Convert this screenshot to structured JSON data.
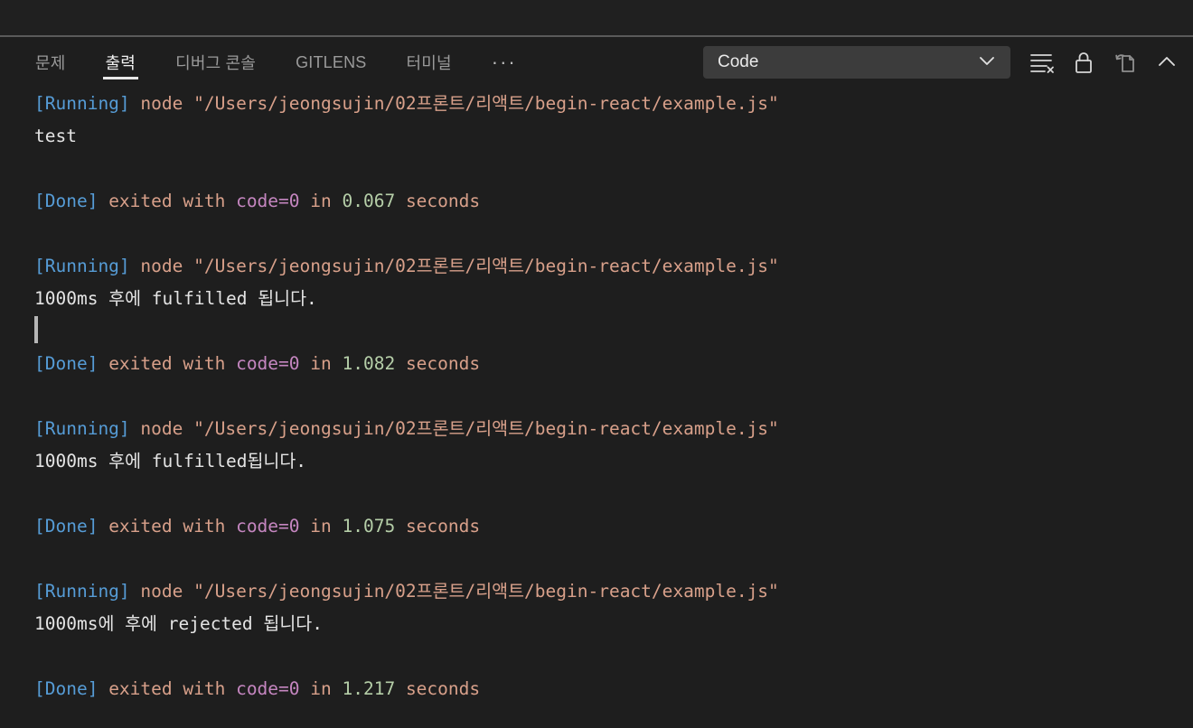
{
  "panel": {
    "tabs": [
      {
        "label": "문제",
        "name": "tab-problems",
        "active": false
      },
      {
        "label": "출력",
        "name": "tab-output",
        "active": true
      },
      {
        "label": "디버그 콘솔",
        "name": "tab-debug-console",
        "active": false
      },
      {
        "label": "GITLENS",
        "name": "tab-gitlens",
        "active": false
      },
      {
        "label": "터미널",
        "name": "tab-terminal",
        "active": false
      }
    ],
    "more_label": "···",
    "channel_select": {
      "value": "Code",
      "icon": "chevron-down-icon"
    },
    "actions": [
      {
        "name": "clear-output-button",
        "icon": "clear-output-icon",
        "title": "Clear Output"
      },
      {
        "name": "turn-auto-scrolling-off-button",
        "icon": "lock-icon",
        "title": "Turn Auto Scrolling Off"
      },
      {
        "name": "open-output-in-editor-button",
        "icon": "open-in-editor-icon",
        "title": "Open Output in Editor"
      },
      {
        "name": "hide-panel-button",
        "icon": "chevron-up-icon",
        "title": "Hide Panel"
      }
    ]
  },
  "colors": {
    "background": "#1e1e1e",
    "tag": "#569cd6",
    "body_text": "#d8a08a",
    "code_value": "#c586c0",
    "number": "#b5cea8",
    "program_output": "#e4e4e4",
    "accent_underline": "#e7e7e7",
    "select_background": "#3c3c3c"
  },
  "output": {
    "command": "node \"/Users/jeongsujin/02프론트/리액트/begin-react/example.js\"",
    "running_tag": "[Running]",
    "done_tag": "[Done]",
    "exited_text": "exited with ",
    "code_text": "code=0",
    "in_text": " in ",
    "seconds_text": " seconds",
    "lines": [
      {
        "type": "running",
        "tag": "[Running]",
        "rest": " node \"/Users/jeongsujin/02프론트/리액트/begin-react/example.js\""
      },
      {
        "type": "stdout",
        "text": "test"
      },
      {
        "type": "blank",
        "text": ""
      },
      {
        "type": "done",
        "tag": "[Done]",
        "pre": " exited with ",
        "code": "code=0",
        "mid": " in ",
        "num": "0.067",
        "post": " seconds"
      },
      {
        "type": "blank",
        "text": ""
      },
      {
        "type": "running",
        "tag": "[Running]",
        "rest": " node \"/Users/jeongsujin/02프론트/리액트/begin-react/example.js\""
      },
      {
        "type": "stdout",
        "text": "1000ms 후에 fulfilled 됩니다."
      },
      {
        "type": "caret",
        "text": ""
      },
      {
        "type": "done",
        "tag": "[Done]",
        "pre": " exited with ",
        "code": "code=0",
        "mid": " in ",
        "num": "1.082",
        "post": " seconds"
      },
      {
        "type": "blank",
        "text": ""
      },
      {
        "type": "running",
        "tag": "[Running]",
        "rest": " node \"/Users/jeongsujin/02프론트/리액트/begin-react/example.js\""
      },
      {
        "type": "stdout",
        "text": "1000ms 후에 fulfilled됩니다."
      },
      {
        "type": "blank",
        "text": ""
      },
      {
        "type": "done",
        "tag": "[Done]",
        "pre": " exited with ",
        "code": "code=0",
        "mid": " in ",
        "num": "1.075",
        "post": " seconds"
      },
      {
        "type": "blank",
        "text": ""
      },
      {
        "type": "running",
        "tag": "[Running]",
        "rest": " node \"/Users/jeongsujin/02프론트/리액트/begin-react/example.js\""
      },
      {
        "type": "stdout",
        "text": "1000ms에 후에 rejected 됩니다."
      },
      {
        "type": "blank",
        "text": ""
      },
      {
        "type": "done",
        "tag": "[Done]",
        "pre": " exited with ",
        "code": "code=0",
        "mid": " in ",
        "num": "1.217",
        "post": " seconds"
      }
    ]
  }
}
